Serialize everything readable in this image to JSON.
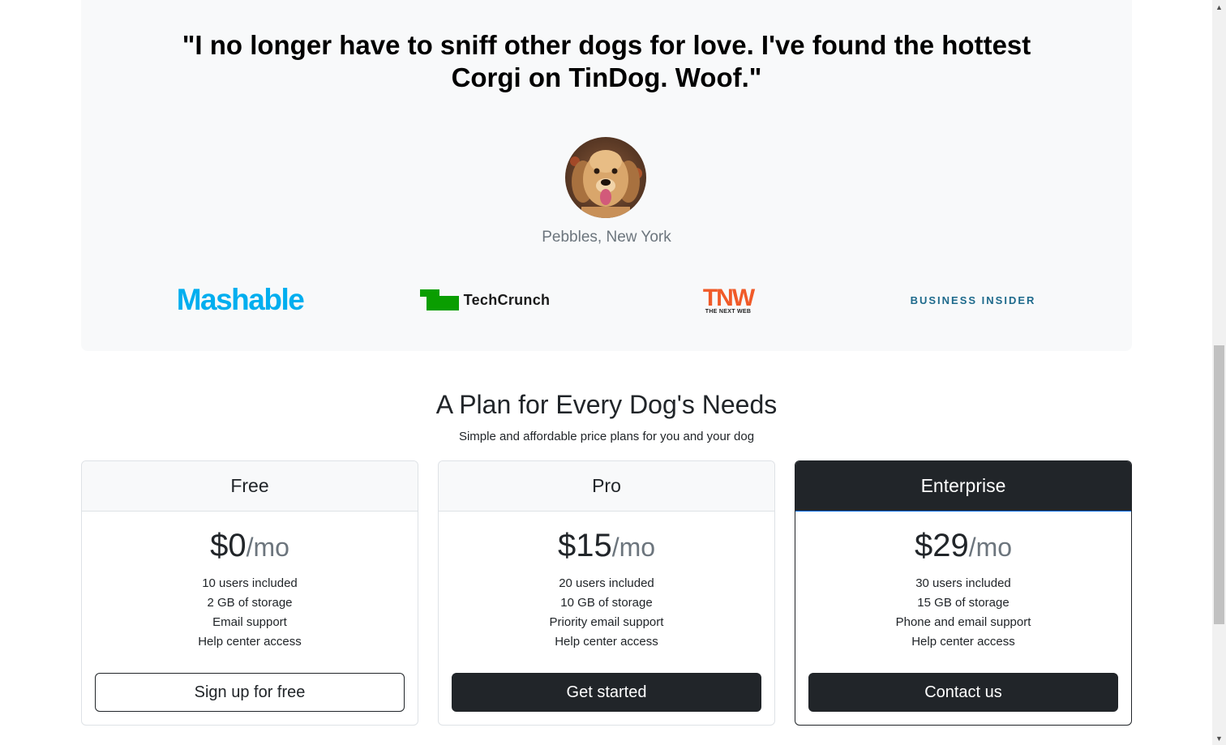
{
  "testimonial": {
    "quote": "\"I no longer have to sniff other dogs for love. I've found the hottest Corgi on TinDog. Woof.\"",
    "author": "Pebbles, New York"
  },
  "press": {
    "mashable": "Mashable",
    "techcrunch": "TechCrunch",
    "tnw": "TNW",
    "tnw_sub": "THE NEXT WEB",
    "business_insider": "BUSINESS INSIDER"
  },
  "pricing": {
    "title": "A Plan for Every Dog's Needs",
    "subtitle": "Simple and affordable price plans for you and your dog",
    "plans": [
      {
        "name": "Free",
        "price": "$0",
        "period": "/mo",
        "features": [
          "10 users included",
          "2 GB of storage",
          "Email support",
          "Help center access"
        ],
        "button": "Sign up for free"
      },
      {
        "name": "Pro",
        "price": "$15",
        "period": "/mo",
        "features": [
          "20 users included",
          "10 GB of storage",
          "Priority email support",
          "Help center access"
        ],
        "button": "Get started"
      },
      {
        "name": "Enterprise",
        "price": "$29",
        "period": "/mo",
        "features": [
          "30 users included",
          "15 GB of storage",
          "Phone and email support",
          "Help center access"
        ],
        "button": "Contact us"
      }
    ]
  },
  "colors": {
    "section_bg": "#f8f9fa",
    "dark": "#212529",
    "mashable": "#00aeef",
    "techcrunch": "#0a9e01",
    "tnw": "#f05a28",
    "business_insider": "#1e6a8c"
  }
}
